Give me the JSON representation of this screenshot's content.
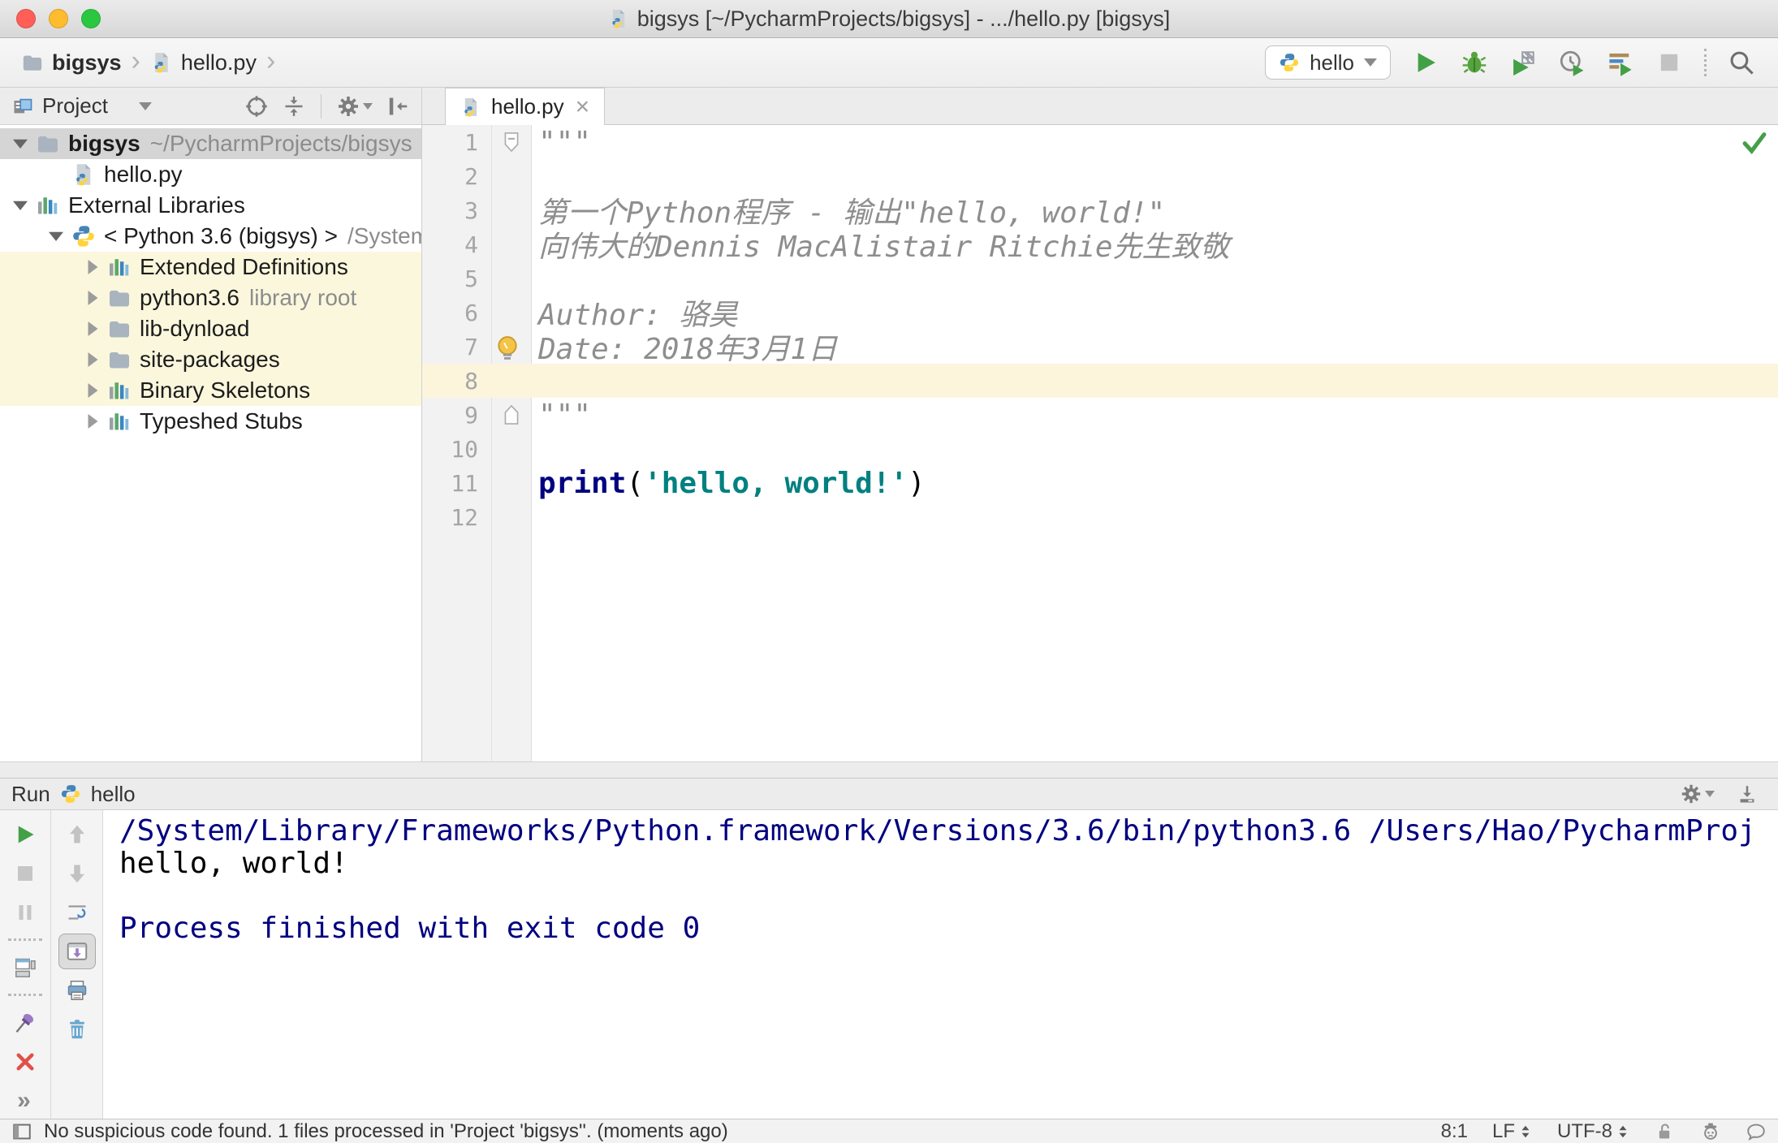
{
  "colors": {
    "keyword": "#000080",
    "string": "#008080",
    "docstring": "#8e8e8e",
    "console_system": "#000080",
    "run_green": "#43a047",
    "current_line": "#fcf5dc",
    "tree_scope_yellow": "#fbf7dd",
    "selection_gray": "#d5d5d5"
  },
  "window": {
    "title": "bigsys [~/PycharmProjects/bigsys] - .../hello.py [bigsys]"
  },
  "toolbar": {
    "breadcrumbs": [
      {
        "label": "bigsys",
        "icon": "folder",
        "bold": true
      },
      {
        "label": "hello.py",
        "icon": "pyfile",
        "bold": false
      }
    ],
    "run_config": {
      "label": "hello",
      "icon": "python"
    },
    "actions": [
      {
        "name": "run",
        "icon": "play"
      },
      {
        "name": "debug",
        "icon": "bug"
      },
      {
        "name": "run-with-coverage",
        "icon": "coverage"
      },
      {
        "name": "profile",
        "icon": "profiler"
      },
      {
        "name": "concurrency-diagram",
        "icon": "concurrency"
      },
      {
        "name": "stop",
        "icon": "stop",
        "disabled": true
      },
      {
        "name": "separator"
      },
      {
        "name": "search-everywhere",
        "icon": "search"
      }
    ]
  },
  "project_panel": {
    "title": "Project",
    "header_actions": [
      {
        "name": "locate",
        "icon": "target"
      },
      {
        "name": "collapse-all",
        "icon": "collapse"
      },
      {
        "name": "separator"
      },
      {
        "name": "settings",
        "icon": "gear",
        "caret": true
      },
      {
        "name": "hide-panel",
        "icon": "hidepanel"
      }
    ],
    "tree": [
      {
        "label": "bigsys",
        "bold": true,
        "hint": "~/PycharmProjects/bigsys",
        "icon": "folder",
        "arrow": "down",
        "indent": 0,
        "selected": true
      },
      {
        "label": "hello.py",
        "icon": "pyfile",
        "arrow": null,
        "indent": 1
      },
      {
        "label": "External Libraries",
        "icon": "lib",
        "arrow": "down",
        "indent": 0
      },
      {
        "label": "< Python 3.6 (bigsys) >",
        "hint": "/System",
        "icon": "python",
        "arrow": "down",
        "indent": 1
      },
      {
        "label": "Extended Definitions",
        "icon": "lib",
        "arrow": "right",
        "indent": 2,
        "highlight": true
      },
      {
        "label": "python3.6",
        "hint": "library root",
        "icon": "folder",
        "arrow": "right",
        "indent": 2,
        "highlight": true
      },
      {
        "label": "lib-dynload",
        "icon": "folder",
        "arrow": "right",
        "indent": 2,
        "highlight": true
      },
      {
        "label": "site-packages",
        "icon": "folder",
        "arrow": "right",
        "indent": 2,
        "highlight": true
      },
      {
        "label": "Binary Skeletons",
        "icon": "lib",
        "arrow": "right",
        "indent": 2,
        "highlight": true
      },
      {
        "label": "Typeshed Stubs",
        "icon": "lib",
        "arrow": "right",
        "indent": 2
      }
    ]
  },
  "editor": {
    "tab": {
      "label": "hello.py",
      "icon": "pyfile"
    },
    "lines": [
      {
        "num": 1,
        "fold": "start",
        "segments": [
          {
            "text": "\"\"\"",
            "style": "doc"
          }
        ]
      },
      {
        "num": 2,
        "segments": []
      },
      {
        "num": 3,
        "segments": [
          {
            "text": "第一个Python程序 - 输出\"hello, world!\"",
            "style": "doc"
          }
        ]
      },
      {
        "num": 4,
        "segments": [
          {
            "text": "向伟大的Dennis MacAlistair Ritchie先生致敬",
            "style": "doc"
          }
        ]
      },
      {
        "num": 5,
        "segments": []
      },
      {
        "num": 6,
        "segments": [
          {
            "text": "Author: 骆昊",
            "style": "doc"
          }
        ]
      },
      {
        "num": 7,
        "bulb": true,
        "segments": [
          {
            "text": "Date: 2018年3月1日",
            "style": "doc"
          }
        ]
      },
      {
        "num": 8,
        "current": true,
        "segments": []
      },
      {
        "num": 9,
        "fold": "end",
        "segments": [
          {
            "text": "\"\"\"",
            "style": "doc"
          }
        ]
      },
      {
        "num": 10,
        "segments": []
      },
      {
        "num": 11,
        "segments": [
          {
            "text": "print",
            "style": "kw"
          },
          {
            "text": "(",
            "style": "plain"
          },
          {
            "text": "'hello, world!'",
            "style": "str"
          },
          {
            "text": ")",
            "style": "plain"
          }
        ]
      },
      {
        "num": 12,
        "segments": []
      }
    ]
  },
  "run_panel": {
    "title": "Run",
    "config": "hello",
    "config_icon": "python",
    "header_actions": [
      {
        "name": "settings",
        "icon": "gear",
        "caret": true
      },
      {
        "name": "hide",
        "icon": "dock"
      }
    ],
    "rail_primary": [
      {
        "name": "rerun",
        "icon": "play"
      },
      {
        "name": "stop",
        "icon": "stop2",
        "disabled": true
      },
      {
        "name": "pause-output",
        "icon": "pause",
        "disabled": true
      },
      {
        "name": "separator"
      },
      {
        "name": "restore-layout",
        "icon": "layout"
      },
      {
        "name": "separator"
      },
      {
        "name": "pin-tab",
        "icon": "pin"
      },
      {
        "name": "close",
        "icon": "close-x"
      },
      {
        "name": "more",
        "label": "»"
      }
    ],
    "rail_secondary": [
      {
        "name": "up-the-stack-trace",
        "icon": "up",
        "disabled": true
      },
      {
        "name": "down-the-stack-trace",
        "icon": "down",
        "disabled": true
      },
      {
        "name": "soft-wrap",
        "icon": "softwrap"
      },
      {
        "name": "scroll-to-end",
        "icon": "scrollend",
        "active": true
      },
      {
        "name": "print",
        "icon": "printer"
      },
      {
        "name": "clear-all",
        "icon": "trash"
      }
    ],
    "console": [
      {
        "text": "/System/Library/Frameworks/Python.framework/Versions/3.6/bin/python3.6 /Users/Hao/PycharmProj",
        "style": "system"
      },
      {
        "text": "hello, world!",
        "style": "stdout"
      },
      {
        "text": "",
        "style": "stdout"
      },
      {
        "text": "Process finished with exit code 0",
        "style": "system"
      }
    ]
  },
  "status_bar": {
    "message": "No suspicious code found. 1 files processed in 'Project 'bigsys''. (moments ago)",
    "widgets": [
      {
        "name": "caret-position",
        "label": "8:1"
      },
      {
        "name": "line-separator",
        "label": "LF",
        "updown": true
      },
      {
        "name": "encoding",
        "label": "UTF-8",
        "updown": true
      },
      {
        "name": "lock",
        "icon": "lock"
      },
      {
        "name": "highlighting-level",
        "icon": "hector"
      },
      {
        "name": "feedback",
        "icon": "bubble"
      }
    ]
  }
}
